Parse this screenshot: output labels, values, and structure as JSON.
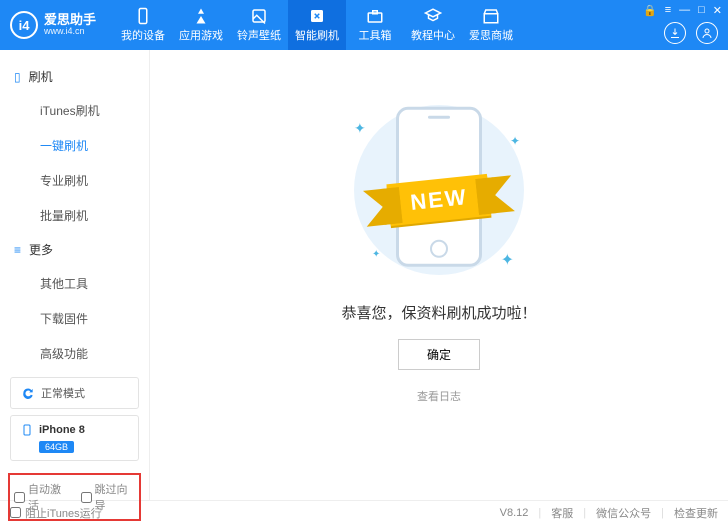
{
  "logo": {
    "badge": "i4",
    "title": "爱思助手",
    "url": "www.i4.cn"
  },
  "tabs": [
    {
      "label": "我的设备"
    },
    {
      "label": "应用游戏"
    },
    {
      "label": "铃声壁纸"
    },
    {
      "label": "智能刷机"
    },
    {
      "label": "工具箱"
    },
    {
      "label": "教程中心"
    },
    {
      "label": "爱思商城"
    }
  ],
  "sidebar": {
    "group1": "刷机",
    "items1": [
      "iTunes刷机",
      "一键刷机",
      "专业刷机",
      "批量刷机"
    ],
    "group2": "更多",
    "items2": [
      "其他工具",
      "下载固件",
      "高级功能"
    ],
    "mode": "正常模式",
    "device": {
      "name": "iPhone 8",
      "storage": "64GB"
    },
    "checks": {
      "autoActivate": "自动激活",
      "skipGuide": "跳过向导"
    }
  },
  "main": {
    "ribbon": "NEW",
    "message": "恭喜您，保资料刷机成功啦！",
    "ok": "确定",
    "log": "查看日志"
  },
  "footer": {
    "blockItunes": "阻止iTunes运行",
    "version": "V8.12",
    "support": "客服",
    "wechat": "微信公众号",
    "update": "检查更新"
  }
}
